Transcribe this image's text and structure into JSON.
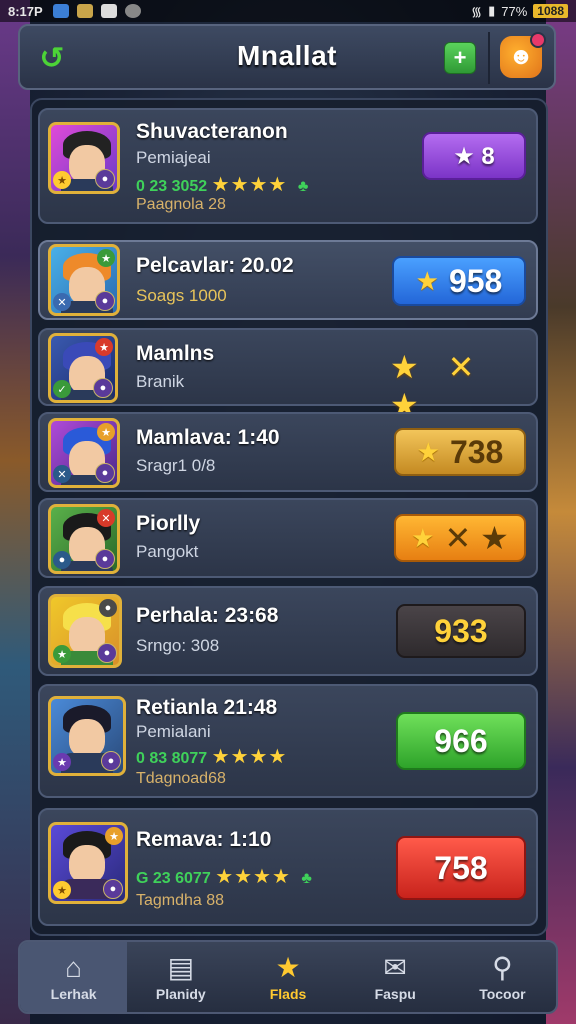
{
  "status_bar": {
    "time": "8:17P",
    "battery_percent": "77%",
    "battery_badge": "1088"
  },
  "header": {
    "title": "Mnallat",
    "back_icon": "back-arrow-icon",
    "plus_label": "+"
  },
  "rows": [
    {
      "name": "Shuvacteranon",
      "sub": "Pemiajeai",
      "stat": "0 23 3052",
      "stars": "★★★★",
      "gem": "♣",
      "foot": "Paagnola 28",
      "action_label": "★  8",
      "action_style": "purple"
    },
    {
      "name": "Pelcavlar: 20.02",
      "sub": "Soags 1000",
      "action_label": "958",
      "action_style": "blue"
    },
    {
      "name": "Mamlns",
      "sub": "Branik",
      "action_label": "★ ✕ ★",
      "action_style": "stars"
    },
    {
      "name": "Mamlava: 1:40",
      "sub": "Sragr1 0/8",
      "action_label": "738",
      "action_style": "gold"
    },
    {
      "name": "Piorlly",
      "sub": "Pangokt",
      "action_label": "✕ ★",
      "action_style": "orange"
    },
    {
      "name": "Perhala: 23:68",
      "sub": "Srngo: 308",
      "action_label": "933",
      "action_style": "dark"
    },
    {
      "name": "Retianla 21:48",
      "sub": "Pemialani",
      "stat": "0 83 8077",
      "stars": "★★★★",
      "foot": "Tdagnoad68",
      "action_label": "966",
      "action_style": "green"
    },
    {
      "name": "Remava: 1:10",
      "stat": "G 23 6077",
      "stars": "★★★★",
      "gem": "♣",
      "foot": "Tagmdha 88",
      "action_label": "758",
      "action_style": "red"
    }
  ],
  "bottom_nav": [
    {
      "label": "Lerhak",
      "icon": "home-icon"
    },
    {
      "label": "Planidy",
      "icon": "planner-icon"
    },
    {
      "label": "Flads",
      "icon": "star-icon"
    },
    {
      "label": "Faspu",
      "icon": "message-icon"
    },
    {
      "label": "Tocoor",
      "icon": "profile-icon"
    }
  ]
}
